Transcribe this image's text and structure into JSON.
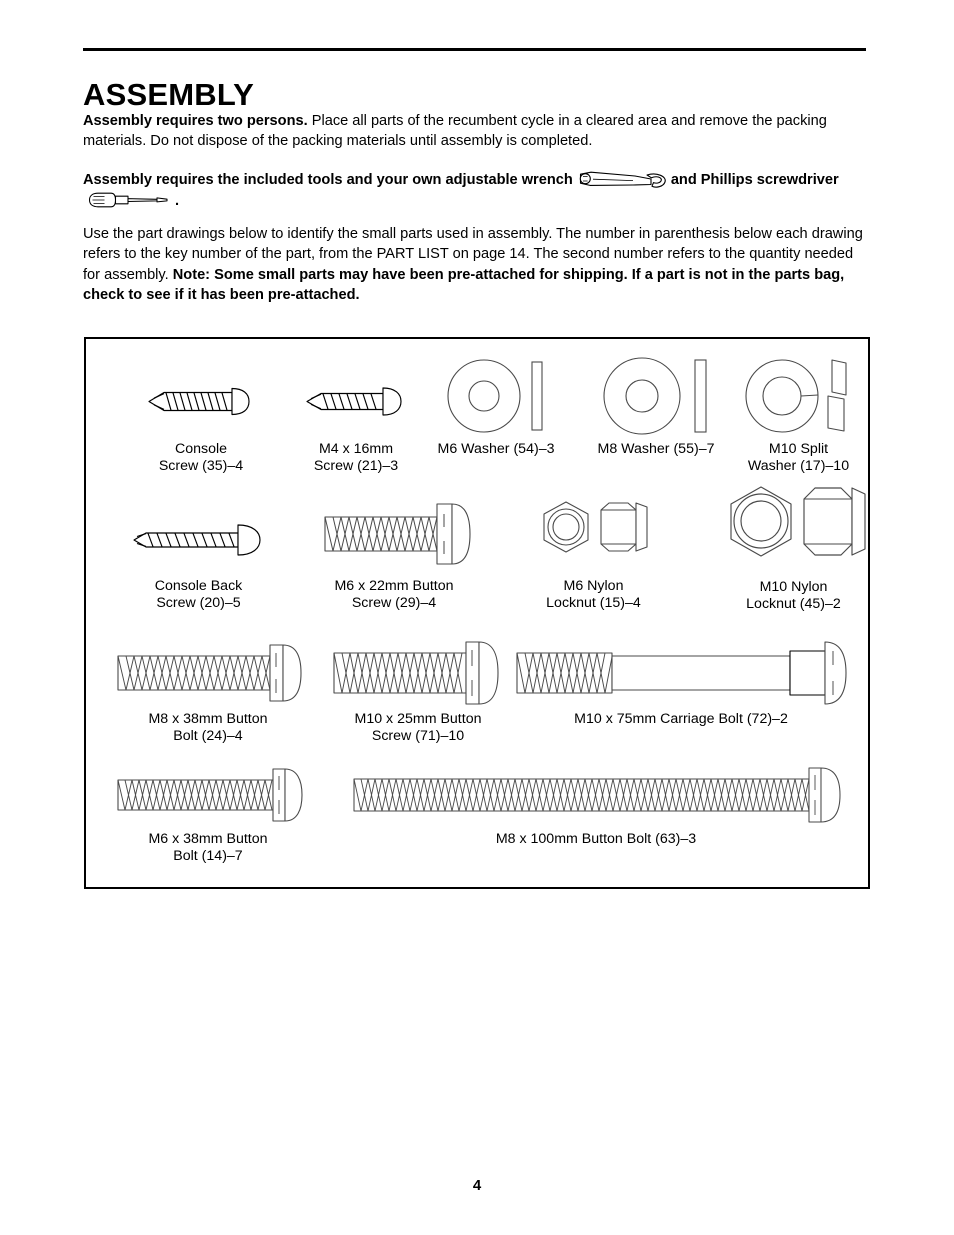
{
  "document": {
    "title": "ASSEMBLY",
    "page_number": "4"
  },
  "paragraphs": {
    "p1_bold": "Assembly requires two persons.",
    "p1_rest": " Place all parts of the recumbent cycle in a cleared area and remove the packing materials. Do not dispose of the packing materials until assembly is completed.",
    "p2_part1": "Assembly requires the included tools and your own adjustable wrench",
    "p2_part2": "and Phillips screwdriver",
    "p2_part3": ".",
    "p3_part1": "Use the part drawings below to identify the small parts used in assembly. The number in parenthesis below each drawing refers to the key number of the part, from the PART LIST on page 14. The second number refers to the quantity needed for assembly. ",
    "p3_bold": "Note: Some small parts may have been pre-attached for shipping. If a part is not in the parts bag, check to see if it has been pre-attached."
  },
  "icons": {
    "wrench": "adjustable-wrench-icon",
    "screwdriver": "phillips-screwdriver-icon"
  },
  "parts": [
    {
      "label": "Console\nScrew (35)–4",
      "type": "wood-screw",
      "key": "35",
      "qty": "4"
    },
    {
      "label": "M4 x 16mm\nScrew (21)–3",
      "type": "wood-screw",
      "key": "21",
      "qty": "3"
    },
    {
      "label": "M6 Washer (54)–3",
      "type": "washer",
      "key": "54",
      "qty": "3"
    },
    {
      "label": "M8 Washer (55)–7",
      "type": "washer",
      "key": "55",
      "qty": "7"
    },
    {
      "label": "M10 Split\nWasher (17)–10",
      "type": "split-washer",
      "key": "17",
      "qty": "10"
    },
    {
      "label": "Console Back\nScrew (20)–5",
      "type": "wood-screw",
      "key": "20",
      "qty": "5"
    },
    {
      "label": "M6 x 22mm Button\nScrew (29)–4",
      "type": "button-bolt",
      "key": "29",
      "qty": "4"
    },
    {
      "label": "M6 Nylon\nLocknut (15)–4",
      "type": "locknut",
      "key": "15",
      "qty": "4"
    },
    {
      "label": "M10 Nylon\nLocknut (45)–2",
      "type": "locknut",
      "key": "45",
      "qty": "2"
    },
    {
      "label": "M8 x 38mm Button\nBolt (24)–4",
      "type": "button-bolt",
      "key": "24",
      "qty": "4"
    },
    {
      "label": "M10 x 25mm Button\nScrew (71)–10",
      "type": "button-bolt",
      "key": "71",
      "qty": "10"
    },
    {
      "label": "M10 x 75mm Carriage Bolt (72)–2",
      "type": "carriage-bolt",
      "key": "72",
      "qty": "2"
    },
    {
      "label": "M6 x 38mm Button\nBolt (14)–7",
      "type": "button-bolt",
      "key": "14",
      "qty": "7"
    },
    {
      "label": "M8 x 100mm Button Bolt (63)–3",
      "type": "button-bolt",
      "key": "63",
      "qty": "3"
    }
  ],
  "colors": {
    "ink": "#000000",
    "line": "#3a3a3a",
    "paper": "#ffffff"
  }
}
